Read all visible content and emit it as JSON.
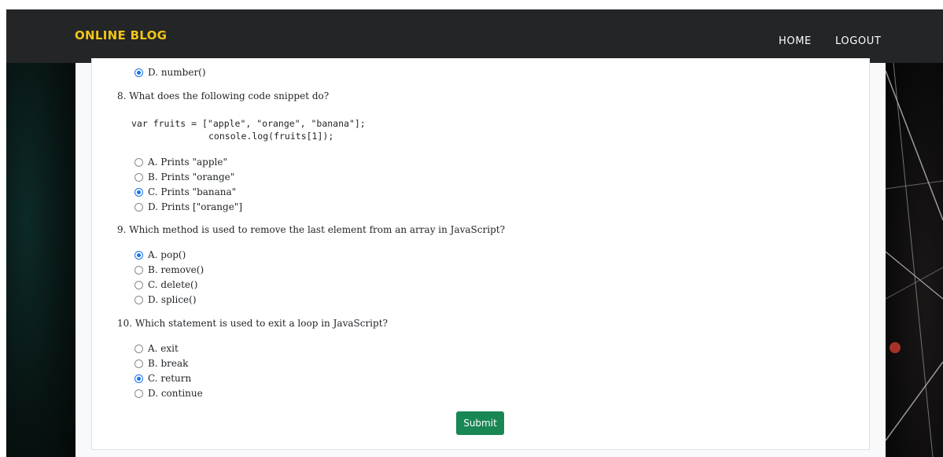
{
  "navbar": {
    "brand": "ONLINE BLOG",
    "links": [
      {
        "label": "HOME"
      },
      {
        "label": "LOGOUT"
      }
    ]
  },
  "quiz": {
    "prev_option": {
      "label": "D. number()",
      "selected": true
    },
    "questions": [
      {
        "number": 8,
        "text": "8. What does the following code snippet do?",
        "code_line1": "var fruits = [\"apple\", \"orange\", \"banana\"];",
        "code_line2": "console.log(fruits[1]);",
        "options": [
          {
            "label": "A. Prints \"apple\"",
            "selected": false
          },
          {
            "label": "B. Prints \"orange\"",
            "selected": false
          },
          {
            "label": "C. Prints \"banana\"",
            "selected": true
          },
          {
            "label": "D. Prints [\"orange\"]",
            "selected": false
          }
        ]
      },
      {
        "number": 9,
        "text": "9. Which method is used to remove the last element from an array in JavaScript?",
        "options": [
          {
            "label": "A. pop()",
            "selected": true
          },
          {
            "label": "B. remove()",
            "selected": false
          },
          {
            "label": "C. delete()",
            "selected": false
          },
          {
            "label": "D. splice()",
            "selected": false
          }
        ]
      },
      {
        "number": 10,
        "text": "10. Which statement is used to exit a loop in JavaScript?",
        "options": [
          {
            "label": "A. exit",
            "selected": false
          },
          {
            "label": "B. break",
            "selected": false
          },
          {
            "label": "C. return",
            "selected": true
          },
          {
            "label": "D. continue",
            "selected": false
          }
        ]
      }
    ],
    "submit_label": "Submit"
  },
  "colors": {
    "navbar_bg": "#232526",
    "brand": "#f0c419",
    "submit_bg": "#198754",
    "radio_selected": "#1a73e8"
  }
}
